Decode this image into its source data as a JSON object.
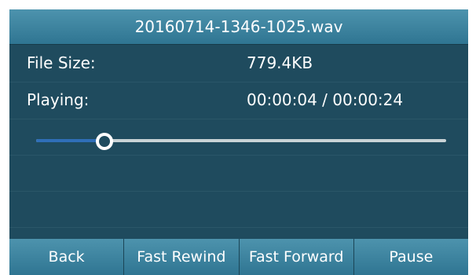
{
  "title": "20160714-1346-1025.wav",
  "file_size": {
    "label": "File Size:",
    "value": "779.4KB"
  },
  "playing": {
    "label": "Playing:",
    "value": "00:00:04 / 00:00:24"
  },
  "progress": {
    "fraction": 0.167
  },
  "colors": {
    "screen_bg": "#1f4b5e",
    "bar_gradient_top": "#4d93ad",
    "bar_gradient_bottom": "#2f7592",
    "progress_fill": "#2f6fb8",
    "track": "#c9d3d6"
  },
  "softkeys": [
    {
      "label": "Back"
    },
    {
      "label": "Fast Rewind"
    },
    {
      "label": "Fast Forward"
    },
    {
      "label": "Pause"
    }
  ]
}
